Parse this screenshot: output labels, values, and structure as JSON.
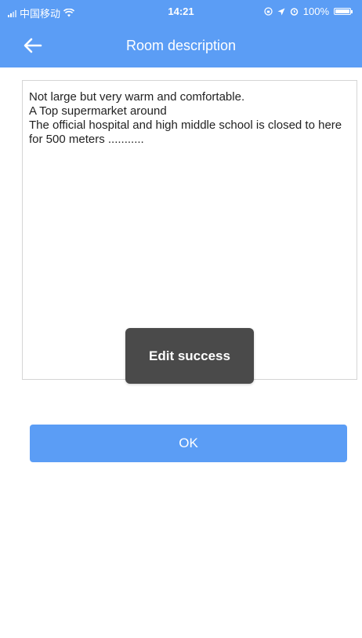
{
  "status_bar": {
    "carrier": "中国移动",
    "time": "14:21",
    "battery_percent": "100%",
    "wifi_icon": "wifi-icon",
    "alarm_icon": "alarm-icon",
    "location_icon": "location-icon",
    "rotation_lock_icon": "rotation-lock-icon"
  },
  "nav": {
    "back_icon": "arrow-left-icon",
    "title": "Room description"
  },
  "description": {
    "text": "Not large but very warm and comfortable.\nA Top supermarket around\nThe official hospital and high middle school is closed to here for 500 meters ..........."
  },
  "toast": {
    "message": "Edit success"
  },
  "actions": {
    "ok_label": "OK"
  },
  "colors": {
    "primary": "#5b9df5",
    "toast_bg": "#4a4a4a",
    "border": "#d5d5d5"
  }
}
